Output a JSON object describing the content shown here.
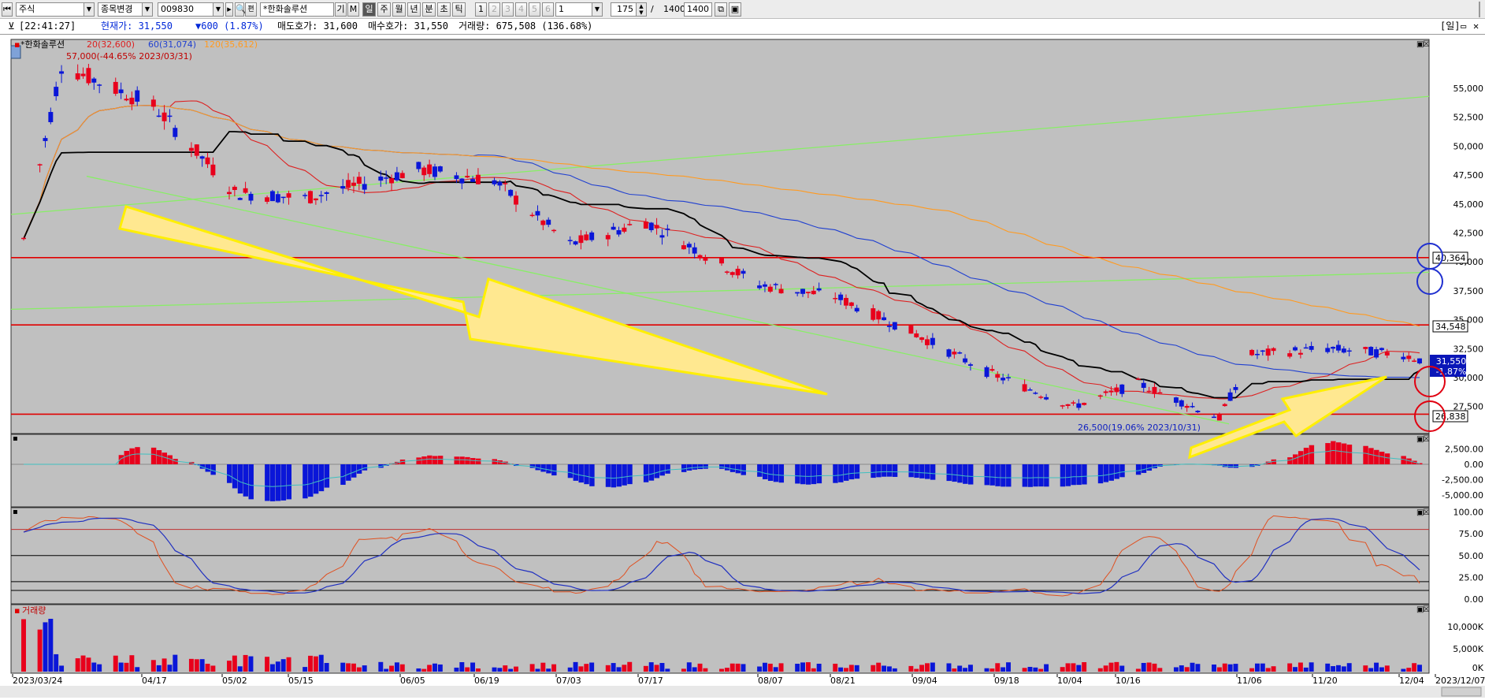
{
  "toolbar": {
    "market": "주식",
    "change_item": "종목변경",
    "code": "009830",
    "name": "*한화솔루션",
    "btn_gi": "기",
    "btn_m": "M",
    "periods": [
      "일",
      "주",
      "월",
      "년",
      "분",
      "초",
      "틱"
    ],
    "active_period": "일",
    "nums": [
      "1",
      "2",
      "3",
      "4",
      "5",
      "6"
    ],
    "num_select": "1",
    "count": "175",
    "slash": "/",
    "total": "1400",
    "total_box": "1400"
  },
  "info": {
    "time": "[22:41:27]",
    "price_label": "현재가: 31,550",
    "change": "▼600 (1.87%)",
    "ask": "매도호가: 31,600",
    "bid": "매수호가: 31,550",
    "volume": "거래량: 675,508 (136.68%)",
    "right_label": "[일]"
  },
  "colors": {
    "up": "#e8001c",
    "down": "#0a16d8",
    "bg": "#c0c0c0",
    "ma20": "#dd2020",
    "ma60": "#2040d0",
    "ma120": "#ff9a20",
    "hline": "#e00000",
    "trend": "#88ee66",
    "arrow": "#ffe890"
  },
  "price_panel": {
    "legend": {
      "name": "*한화솔루션",
      "ma20": "20(32,600)",
      "ma60": "60(31,074)",
      "ma120": "120(35,612)",
      "high_note": "57,000(-44.65% 2023/03/31)"
    },
    "low_note": "26,500(19.06% 2023/10/31)",
    "y_ticks": [
      "55,000",
      "52,500",
      "50,000",
      "47,500",
      "45,000",
      "42,500",
      "40,000",
      "37,500",
      "35,000",
      "32,500",
      "30,000",
      "27,500"
    ],
    "tags": {
      "h1": "40,364",
      "h2": "34,548",
      "h3": "26,838",
      "cur_price": "31,550",
      "cur_change": "-1.87%"
    }
  },
  "macd_panel": {
    "y_ticks": [
      "2,500.00",
      "0.00",
      "-2,500.00",
      "-5,000.00"
    ]
  },
  "stoch_panel": {
    "y_ticks": [
      "100.00",
      "75.00",
      "50.00",
      "25.00",
      "0.00"
    ]
  },
  "volume_panel": {
    "label": "거래량",
    "y_ticks": [
      "10,000K",
      "5,000K",
      "0K"
    ]
  },
  "x_labels": [
    "2023/03/24",
    "04/17",
    "05/02",
    "05/15",
    "06/05",
    "06/19",
    "07/03",
    "07/17",
    "08/07",
    "08/21",
    "09/04",
    "09/18",
    "10/04",
    "10/16",
    "11/06",
    "11/20",
    "12/04",
    "2023/12/07"
  ],
  "chart_data": {
    "type": "candlestick",
    "date_range": [
      "2023/03/24",
      "2023/12/07"
    ],
    "ylim": [
      26000,
      57000
    ],
    "key_points": [
      {
        "date": "2023/03/24",
        "close": 42000
      },
      {
        "date": "2023/03/31",
        "high": 57000
      },
      {
        "date": "2023/04/17",
        "close": 53500
      },
      {
        "date": "2023/05/02",
        "close": 46000
      },
      {
        "date": "2023/05/15",
        "close": 45500
      },
      {
        "date": "2023/06/05",
        "close": 48000
      },
      {
        "date": "2023/06/19",
        "close": 47000
      },
      {
        "date": "2023/07/03",
        "close": 41500
      },
      {
        "date": "2023/07/17",
        "close": 43500
      },
      {
        "date": "2023/08/07",
        "close": 38000
      },
      {
        "date": "2023/08/21",
        "close": 37000
      },
      {
        "date": "2023/09/04",
        "close": 34000
      },
      {
        "date": "2023/09/18",
        "close": 30500
      },
      {
        "date": "2023/10/04",
        "close": 27500
      },
      {
        "date": "2023/10/16",
        "close": 29500
      },
      {
        "date": "2023/10/31",
        "low": 26500
      },
      {
        "date": "2023/11/06",
        "close": 32000
      },
      {
        "date": "2023/11/20",
        "close": 32500
      },
      {
        "date": "2023/12/04",
        "close": 32000
      },
      {
        "date": "2023/12/07",
        "close": 31550
      }
    ],
    "horizontal_levels": [
      40364,
      34548,
      26838
    ],
    "moving_averages": {
      "ma20": 32600,
      "ma60": 31074,
      "ma120": 35612
    },
    "stochastic_levels": [
      80,
      50,
      20,
      10
    ]
  }
}
